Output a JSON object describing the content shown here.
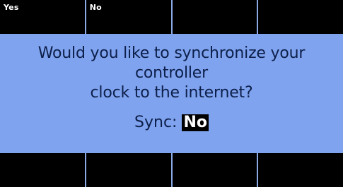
{
  "softkeys_top": [
    {
      "label": "Yes"
    },
    {
      "label": "No"
    },
    {
      "label": ""
    },
    {
      "label": ""
    }
  ],
  "softkeys_bottom": [
    {
      "label": ""
    },
    {
      "label": ""
    },
    {
      "label": ""
    },
    {
      "label": ""
    }
  ],
  "dialog": {
    "line1": "Would you like to synchronize your controller",
    "line2": "clock to the internet?",
    "sync_label": "Sync:",
    "sync_value": "No"
  },
  "colors": {
    "panel_background": "#7fa3ee",
    "softkey_background": "#000000",
    "text": "#0d1f4a",
    "selection_background": "#000000"
  }
}
